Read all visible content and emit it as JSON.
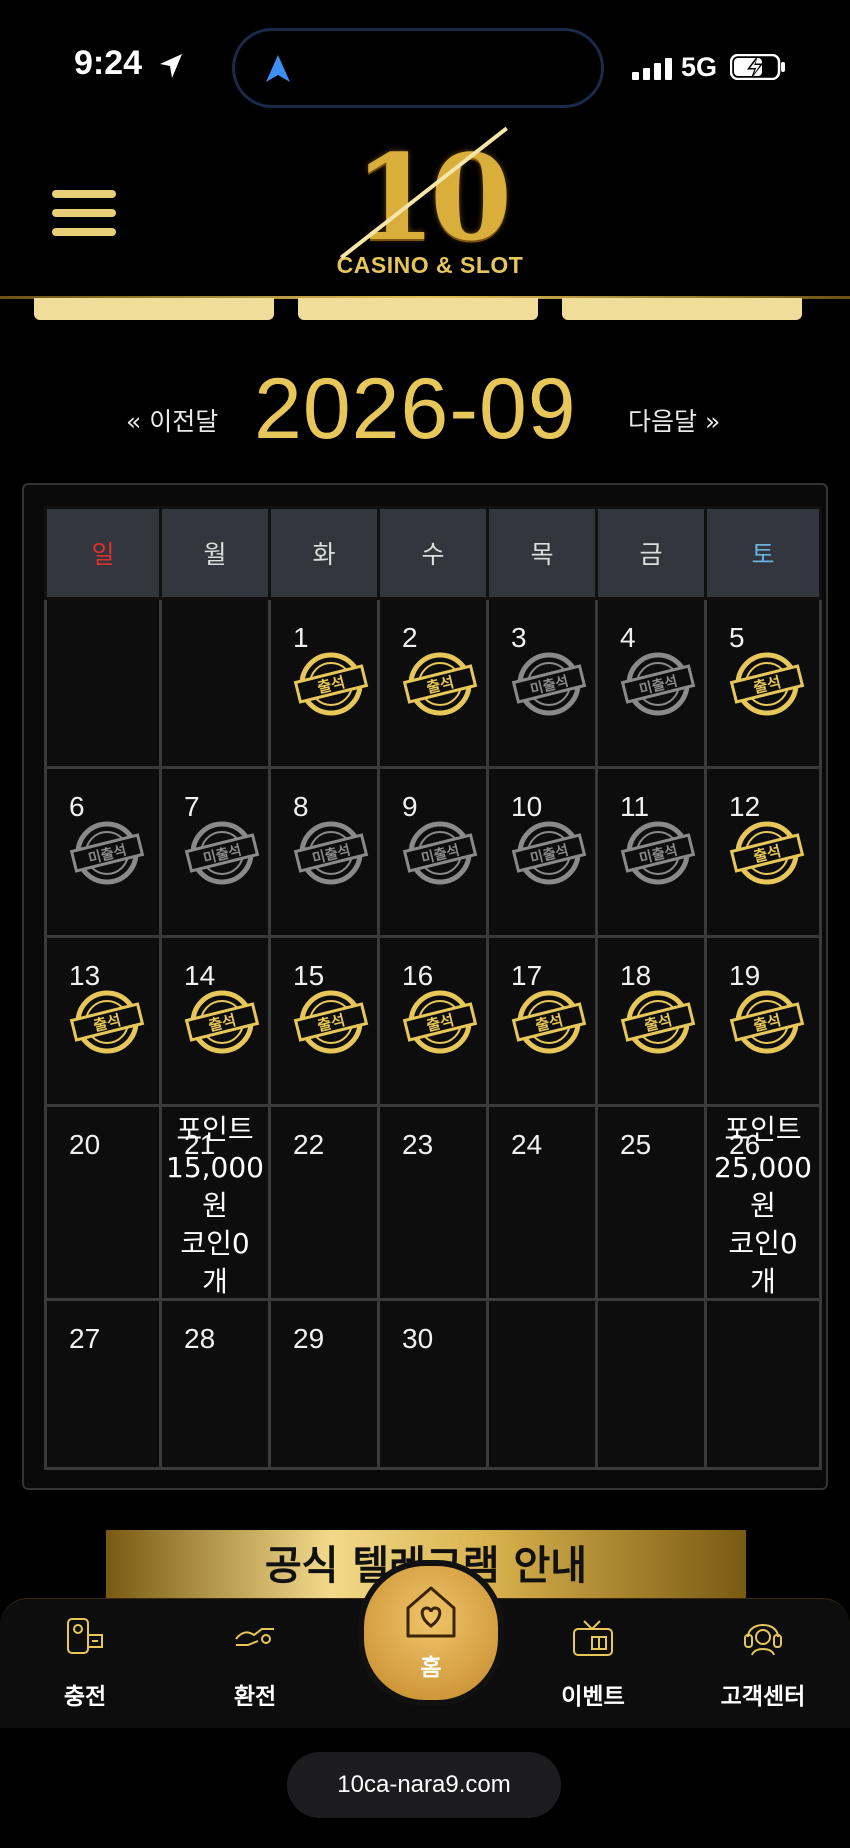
{
  "status_bar": {
    "time": "9:24",
    "network": "5G"
  },
  "header": {
    "logo_number": "10",
    "logo_subtitle": "CASINO & SLOT"
  },
  "calendar": {
    "prev_label": "« 이전달",
    "month": "2026-09",
    "next_label": "다음달 »",
    "weekdays": [
      "일",
      "월",
      "화",
      "수",
      "목",
      "금",
      "토"
    ],
    "stamp_attended": "출석",
    "stamp_absent": "미출석",
    "weeks": [
      [
        {
          "day": ""
        },
        {
          "day": ""
        },
        {
          "day": "1",
          "stamp": "attended"
        },
        {
          "day": "2",
          "stamp": "attended"
        },
        {
          "day": "3",
          "stamp": "absent"
        },
        {
          "day": "4",
          "stamp": "absent"
        },
        {
          "day": "5",
          "stamp": "attended"
        }
      ],
      [
        {
          "day": "6",
          "stamp": "absent"
        },
        {
          "day": "7",
          "stamp": "absent"
        },
        {
          "day": "8",
          "stamp": "absent"
        },
        {
          "day": "9",
          "stamp": "absent"
        },
        {
          "day": "10",
          "stamp": "absent"
        },
        {
          "day": "11",
          "stamp": "absent"
        },
        {
          "day": "12",
          "stamp": "attended"
        }
      ],
      [
        {
          "day": "13",
          "stamp": "attended"
        },
        {
          "day": "14",
          "stamp": "attended"
        },
        {
          "day": "15",
          "stamp": "attended"
        },
        {
          "day": "16",
          "stamp": "attended"
        },
        {
          "day": "17",
          "stamp": "attended"
        },
        {
          "day": "18",
          "stamp": "attended"
        },
        {
          "day": "19",
          "stamp": "attended"
        }
      ],
      [
        {
          "day": "20"
        },
        {
          "day": "21",
          "note": "포인트\n15,000\n원\n코인0\n개"
        },
        {
          "day": "22"
        },
        {
          "day": "23"
        },
        {
          "day": "24"
        },
        {
          "day": "25"
        },
        {
          "day": "26",
          "note": "포인트\n25,000\n원\n코인0\n개"
        }
      ],
      [
        {
          "day": "27"
        },
        {
          "day": "28"
        },
        {
          "day": "29"
        },
        {
          "day": "30"
        },
        {
          "day": ""
        },
        {
          "day": ""
        },
        {
          "day": ""
        }
      ]
    ]
  },
  "banner": {
    "text": "공식 텔레그램 안내"
  },
  "bottom_nav": {
    "deposit": "충전",
    "withdraw": "환전",
    "home": "홈",
    "event": "이벤트",
    "support": "고객센터"
  },
  "browser": {
    "url": "10ca-nara9.com"
  },
  "colors": {
    "gold": "#e8c75a",
    "sunday": "#e0302a",
    "saturday": "#6ab0e0",
    "absent_gray": "#8a8a8a"
  }
}
